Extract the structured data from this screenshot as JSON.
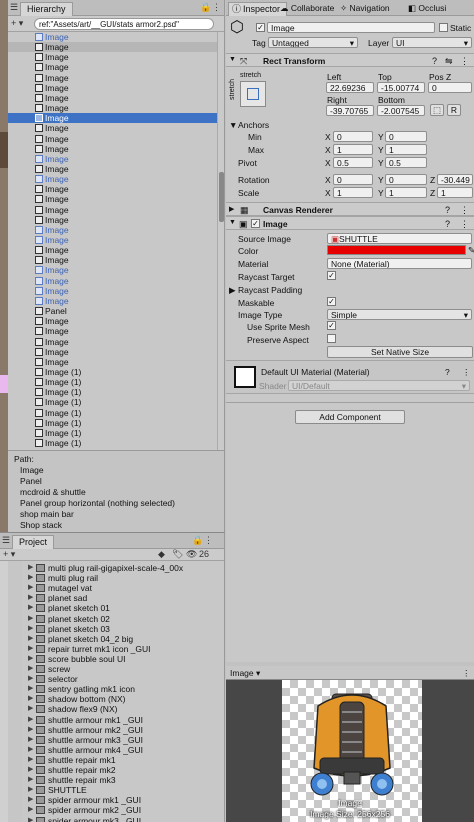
{
  "hierarchy": {
    "tab": "Hierarchy",
    "search": "ref:\"Assets/art/__GUI/stats armor2.psd\"",
    "rows": [
      {
        "label": "Image",
        "style": "blue"
      },
      {
        "label": "Image",
        "style": "hl"
      },
      {
        "label": "Image",
        "style": ""
      },
      {
        "label": "Image",
        "style": ""
      },
      {
        "label": "Image",
        "style": ""
      },
      {
        "label": "Image",
        "style": ""
      },
      {
        "label": "Image",
        "style": ""
      },
      {
        "label": "Image",
        "style": ""
      },
      {
        "label": "Image",
        "style": "sel"
      },
      {
        "label": "Image",
        "style": ""
      },
      {
        "label": "Image",
        "style": ""
      },
      {
        "label": "Image",
        "style": ""
      },
      {
        "label": "Image",
        "style": "blue"
      },
      {
        "label": "Image",
        "style": ""
      },
      {
        "label": "Image",
        "style": "blue"
      },
      {
        "label": "Image",
        "style": ""
      },
      {
        "label": "Image",
        "style": ""
      },
      {
        "label": "Image",
        "style": ""
      },
      {
        "label": "Image",
        "style": ""
      },
      {
        "label": "Image",
        "style": "blue"
      },
      {
        "label": "Image",
        "style": "blue"
      },
      {
        "label": "Image",
        "style": ""
      },
      {
        "label": "Image",
        "style": ""
      },
      {
        "label": "Image",
        "style": "blue"
      },
      {
        "label": "Image",
        "style": "blue"
      },
      {
        "label": "Image",
        "style": "blue"
      },
      {
        "label": "Image",
        "style": "blue"
      },
      {
        "label": "Panel",
        "style": ""
      },
      {
        "label": "Image",
        "style": ""
      },
      {
        "label": "Image",
        "style": ""
      },
      {
        "label": "Image",
        "style": ""
      },
      {
        "label": "Image",
        "style": ""
      },
      {
        "label": "Image",
        "style": ""
      },
      {
        "label": "Image (1)",
        "style": ""
      },
      {
        "label": "Image (1)",
        "style": ""
      },
      {
        "label": "Image (1)",
        "style": ""
      },
      {
        "label": "Image (1)",
        "style": ""
      },
      {
        "label": "Image (1)",
        "style": ""
      },
      {
        "label": "Image (1)",
        "style": ""
      },
      {
        "label": "Image (1)",
        "style": ""
      },
      {
        "label": "Image (1)",
        "style": ""
      }
    ],
    "path_title": "Path:",
    "path": [
      "Image",
      "Panel",
      "mcdroid & shuttle",
      "Panel group horizontal (nothing selected)",
      "shop main bar",
      "Shop stack"
    ]
  },
  "project": {
    "tab": "Project",
    "count": "26",
    "rows": [
      "multi plug rail-gigapixel-scale-4_00x",
      "multi plug rail",
      "mutagel vat",
      "planet sad",
      "planet sketch 01",
      "planet sketch 02",
      "planet sketch 03",
      "planet sketch 04_2 big",
      "repair turret mk1 icon _GUI",
      "score bubble soul UI",
      "screw",
      "selector",
      "sentry gatling mk1 icon",
      "shadow bottom (NX)",
      "shadow flex9 (NX)",
      "shuttle armour mk1 _GUI",
      "shuttle armour mk2 _GUI",
      "shuttle armour mk3 _GUI",
      "shuttle armour mk4 _GUI",
      "shuttle repair mk1",
      "shuttle repair mk2",
      "shuttle repair mk3",
      "SHUTTLE",
      "spider armour mk1 _GUI",
      "spider armour mk2 _GUI",
      "spider armour mk3 _GUI"
    ]
  },
  "inspector": {
    "tabs": [
      "Inspector",
      "Collaborate",
      "Navigation",
      "Occlusi"
    ],
    "object_name": "Image",
    "static_label": "Static",
    "tag_label": "Tag",
    "tag_value": "Untagged",
    "layer_label": "Layer",
    "layer_value": "UI",
    "rect_transform": "Rect Transform",
    "stretch": "stretch",
    "left_label": "Left",
    "left_value": "22.69236",
    "top_label": "Top",
    "top_value": "-15.00774",
    "posz_label": "Pos Z",
    "posz_value": "0",
    "right_label": "Right",
    "right_value": "-39.70765",
    "bottom_label": "Bottom",
    "bottom_value": "-2.007545",
    "r_label": "R",
    "anchors": "Anchors",
    "min_label": "Min",
    "min_x": "0",
    "min_y": "0",
    "max_label": "Max",
    "max_x": "1",
    "max_y": "1",
    "pivot_label": "Pivot",
    "pivot_x": "0.5",
    "pivot_y": "0.5",
    "rotation_label": "Rotation",
    "rot_x": "0",
    "rot_y": "0",
    "rot_z": "-30.449",
    "scale_label": "Scale",
    "scale_x": "1",
    "scale_y": "1",
    "scale_z": "1",
    "x": "X",
    "y": "Y",
    "z": "Z",
    "canvas_renderer": "Canvas Renderer",
    "image_component": "Image",
    "source_image_label": "Source Image",
    "source_image_value": "SHUTTLE",
    "color_label": "Color",
    "color_value": "#e60000",
    "material_label": "Material",
    "material_value": "None (Material)",
    "raycast_target_label": "Raycast Target",
    "raycast_padding_label": "Raycast Padding",
    "maskable_label": "Maskable",
    "image_type_label": "Image Type",
    "image_type_value": "Simple",
    "use_sprite_mesh_label": "Use Sprite Mesh",
    "preserve_aspect_label": "Preserve Aspect",
    "set_native_size": "Set Native Size",
    "default_material": "Default UI Material (Material)",
    "shader_label": "Shader",
    "shader_value": "UI/Default",
    "add_component": "Add Component"
  },
  "preview": {
    "dropdown": "Image",
    "caption_name": "Image",
    "caption_size": "Image Size: 256x256"
  }
}
